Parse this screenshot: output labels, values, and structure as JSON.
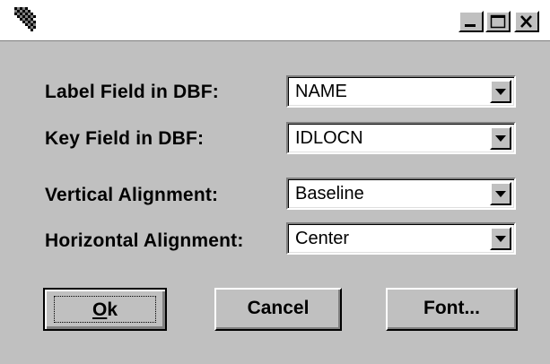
{
  "window": {
    "controls": {
      "minimize_icon": "minimize-icon",
      "maximize_icon": "maximize-icon",
      "close_icon": "close-icon"
    }
  },
  "form": {
    "label_field": {
      "label": "Label Field in DBF:",
      "value": "NAME"
    },
    "key_field": {
      "label": "Key Field in DBF:",
      "value": "IDLOCN"
    },
    "vertical_alignment": {
      "label": "Vertical Alignment:",
      "value": "Baseline"
    },
    "horizontal_alignment": {
      "label": "Horizontal Alignment:",
      "value": "Center"
    }
  },
  "buttons": {
    "ok_mnemonic": "O",
    "ok_rest": "k",
    "cancel": "Cancel",
    "font": "Font..."
  },
  "colors": {
    "face": "#c0c0c0",
    "highlight": "#ffffff",
    "shadow": "#808080",
    "dark": "#000000"
  }
}
